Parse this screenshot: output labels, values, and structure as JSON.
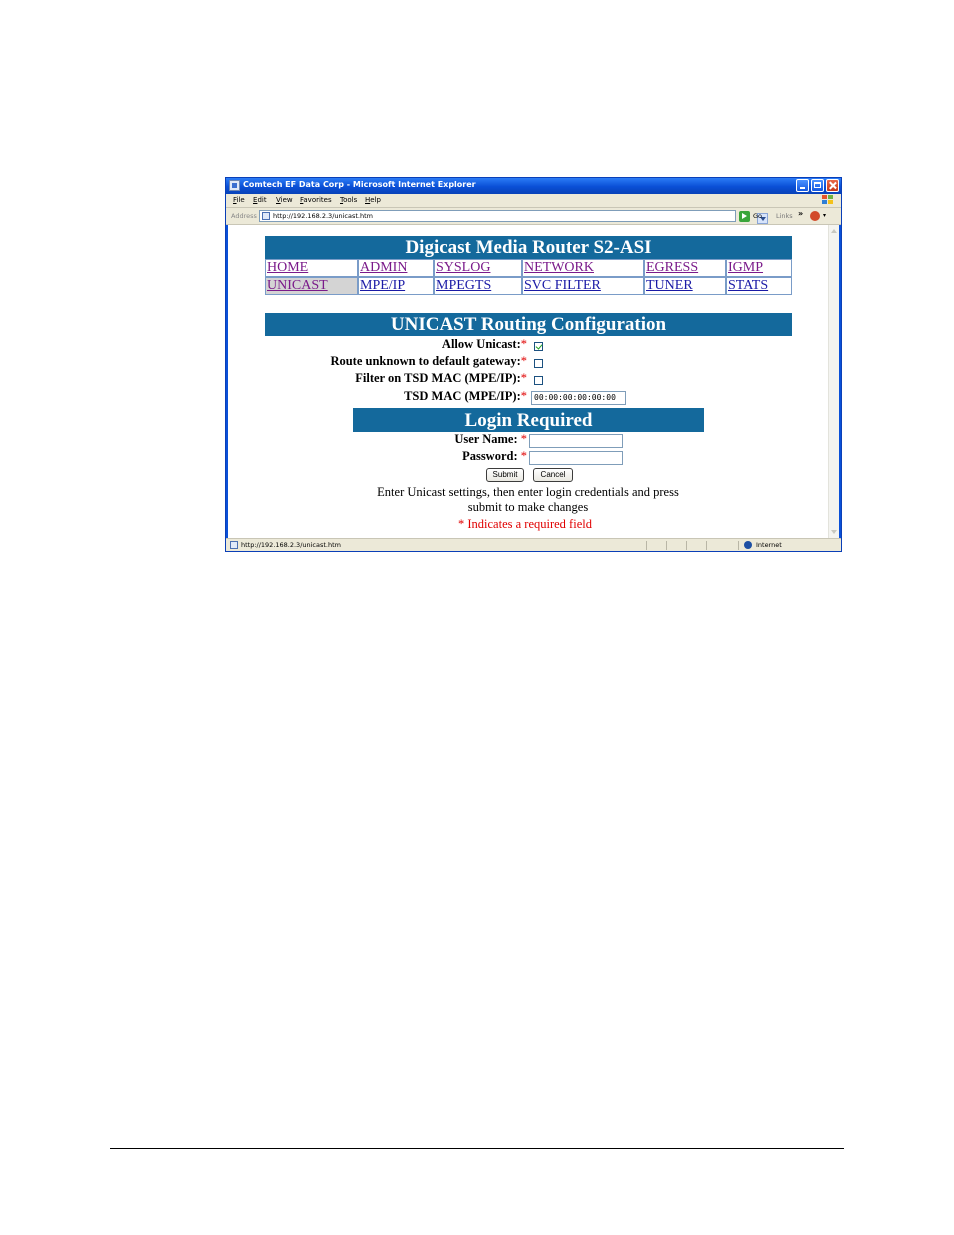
{
  "window": {
    "title": "Comtech EF Data Corp - Microsoft Internet Explorer"
  },
  "menu": [
    "File",
    "Edit",
    "View",
    "Favorites",
    "Tools",
    "Help"
  ],
  "address_bar": {
    "label": "Address",
    "url": "http://192.168.2.3/unicast.htm",
    "go_label": "Go",
    "links_label": "Links"
  },
  "status_bar": {
    "text": "http://192.168.2.3/unicast.htm",
    "zone": "Internet"
  },
  "page": {
    "title": "Digicast Media Router S2-ASI",
    "nav": [
      [
        "HOME",
        "ADMIN",
        "SYSLOG",
        "NETWORK",
        "EGRESS",
        "IGMP"
      ],
      [
        "UNICAST",
        "MPE/IP",
        "MPEGTS",
        "SVC FILTER",
        "TUNER",
        "STATS"
      ]
    ],
    "nav_active": "UNICAST",
    "section_title": "UNICAST Routing Configuration",
    "fields": {
      "allow_unicast": {
        "label": "Allow Unicast:",
        "checked": true
      },
      "route_unknown": {
        "label": "Route unknown to default gateway:",
        "checked": false
      },
      "filter_tsd": {
        "label": "Filter on TSD MAC (MPE/IP):",
        "checked": false
      },
      "tsd_mac": {
        "label": "TSD MAC (MPE/IP):",
        "value": "00:00:00:00:00:00"
      }
    },
    "login": {
      "title": "Login Required",
      "username_label": "User Name:",
      "username_value": "",
      "password_label": "Password:",
      "password_value": "",
      "submit_label": "Submit",
      "cancel_label": "Cancel"
    },
    "instructions_line1": "Enter Unicast settings, then enter login credentials and press",
    "instructions_line2": "submit to make changes",
    "required_note": "* Indicates a required field",
    "required_mark": "*"
  },
  "colors": {
    "header_bg": "#14699c",
    "link": "#1a1aa6",
    "visited_link": "#7a1a8a",
    "required": "#e00000"
  }
}
